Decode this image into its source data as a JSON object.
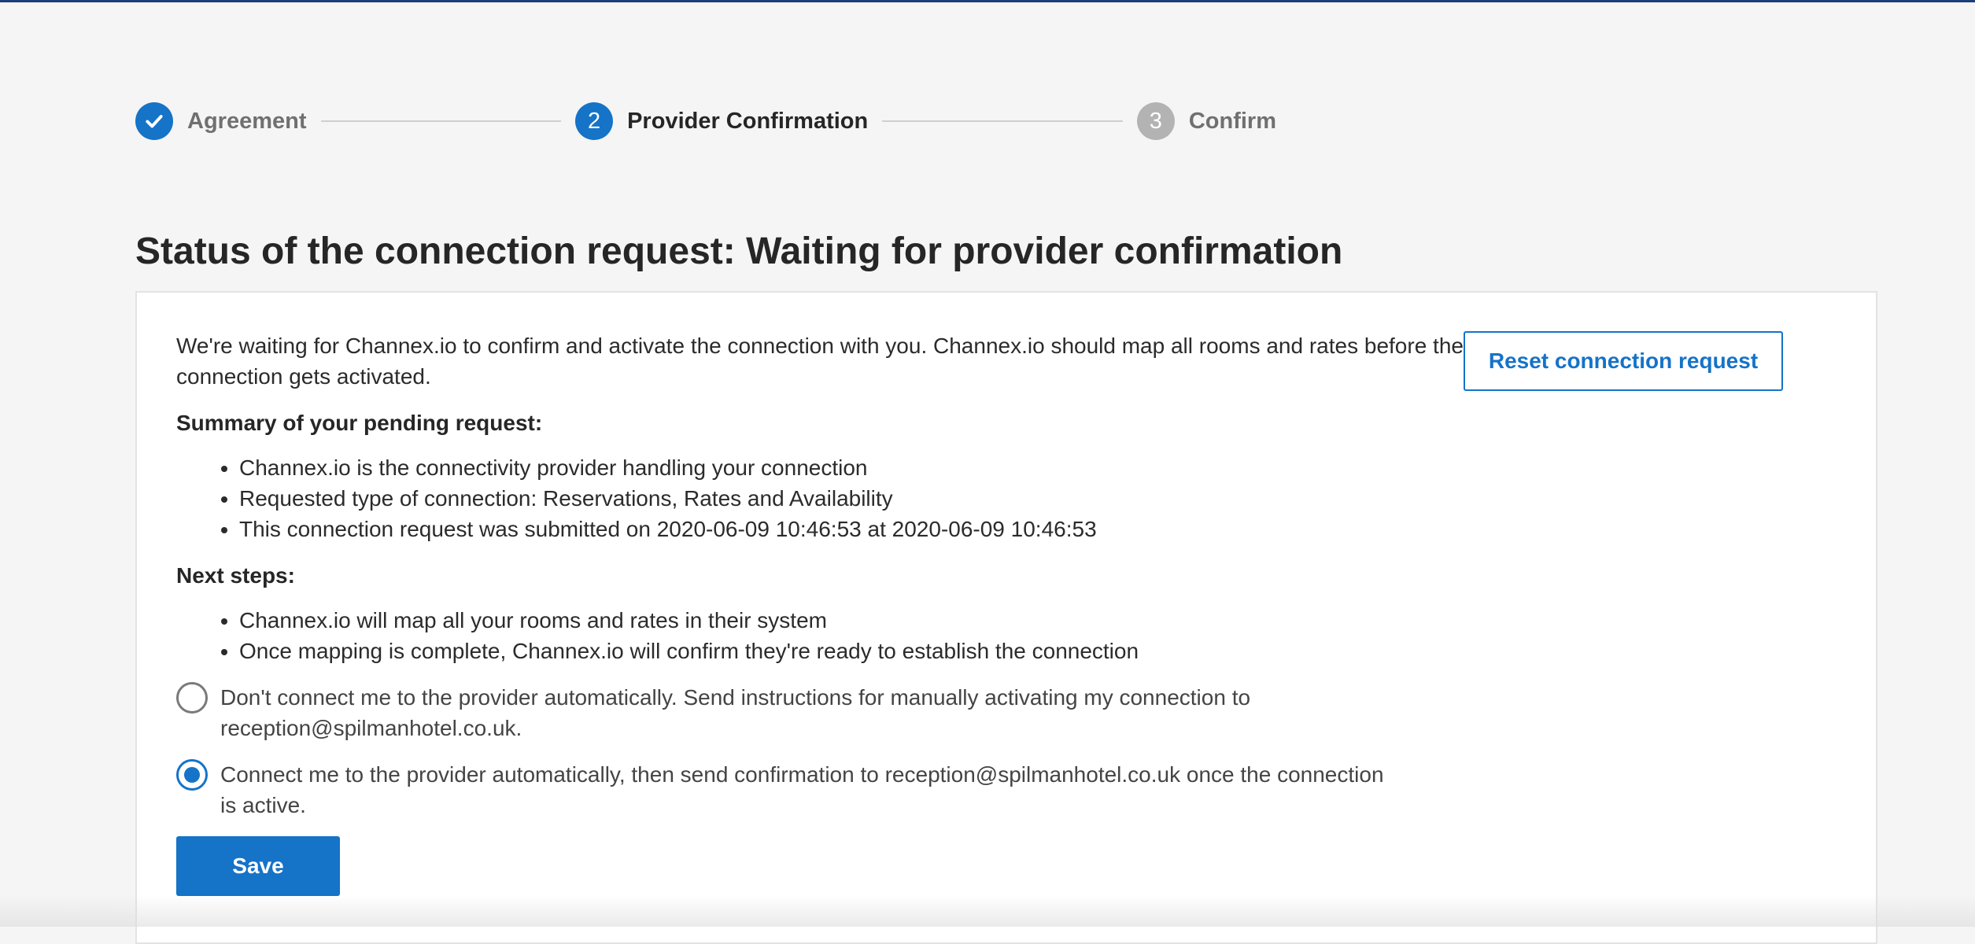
{
  "stepper": {
    "steps": [
      {
        "label": "Agreement",
        "state": "done",
        "marker": "✔",
        "icon": "checkmark-icon"
      },
      {
        "label": "Provider Confirmation",
        "state": "active",
        "marker": "2"
      },
      {
        "label": "Confirm",
        "state": "pending",
        "marker": "3"
      }
    ]
  },
  "page": {
    "title": "Status of the connection request: Waiting for provider confirmation"
  },
  "card": {
    "intro": "We're waiting for Channex.io to confirm and activate the connection with you. Channex.io should map all rooms and rates before the connection gets activated.",
    "reset_button": "Reset connection request",
    "summary_title": "Summary of your pending request:",
    "summary_items": [
      "Channex.io is the connectivity provider handling your connection",
      "Requested type of connection: Reservations, Rates and Availability",
      "This connection request was submitted on 2020-06-09 10:46:53 at 2020-06-09 10:46:53"
    ],
    "next_steps_title": "Next steps:",
    "next_steps_items": [
      "Channex.io will map all your rooms and rates in their system",
      "Once mapping is complete, Channex.io will confirm they're ready to establish the connection"
    ],
    "options": [
      {
        "label": "Don't connect me to the provider automatically. Send instructions for manually activating my connection to reception@spilmanhotel.co.uk.",
        "selected": false
      },
      {
        "label": "Connect me to the provider automatically, then send confirmation to reception@spilmanhotel.co.uk once the connection is active.",
        "selected": true
      }
    ],
    "save_button": "Save"
  },
  "colors": {
    "accent": "#1573c8",
    "pending": "#b3b3b3",
    "background": "#f5f5f5"
  }
}
